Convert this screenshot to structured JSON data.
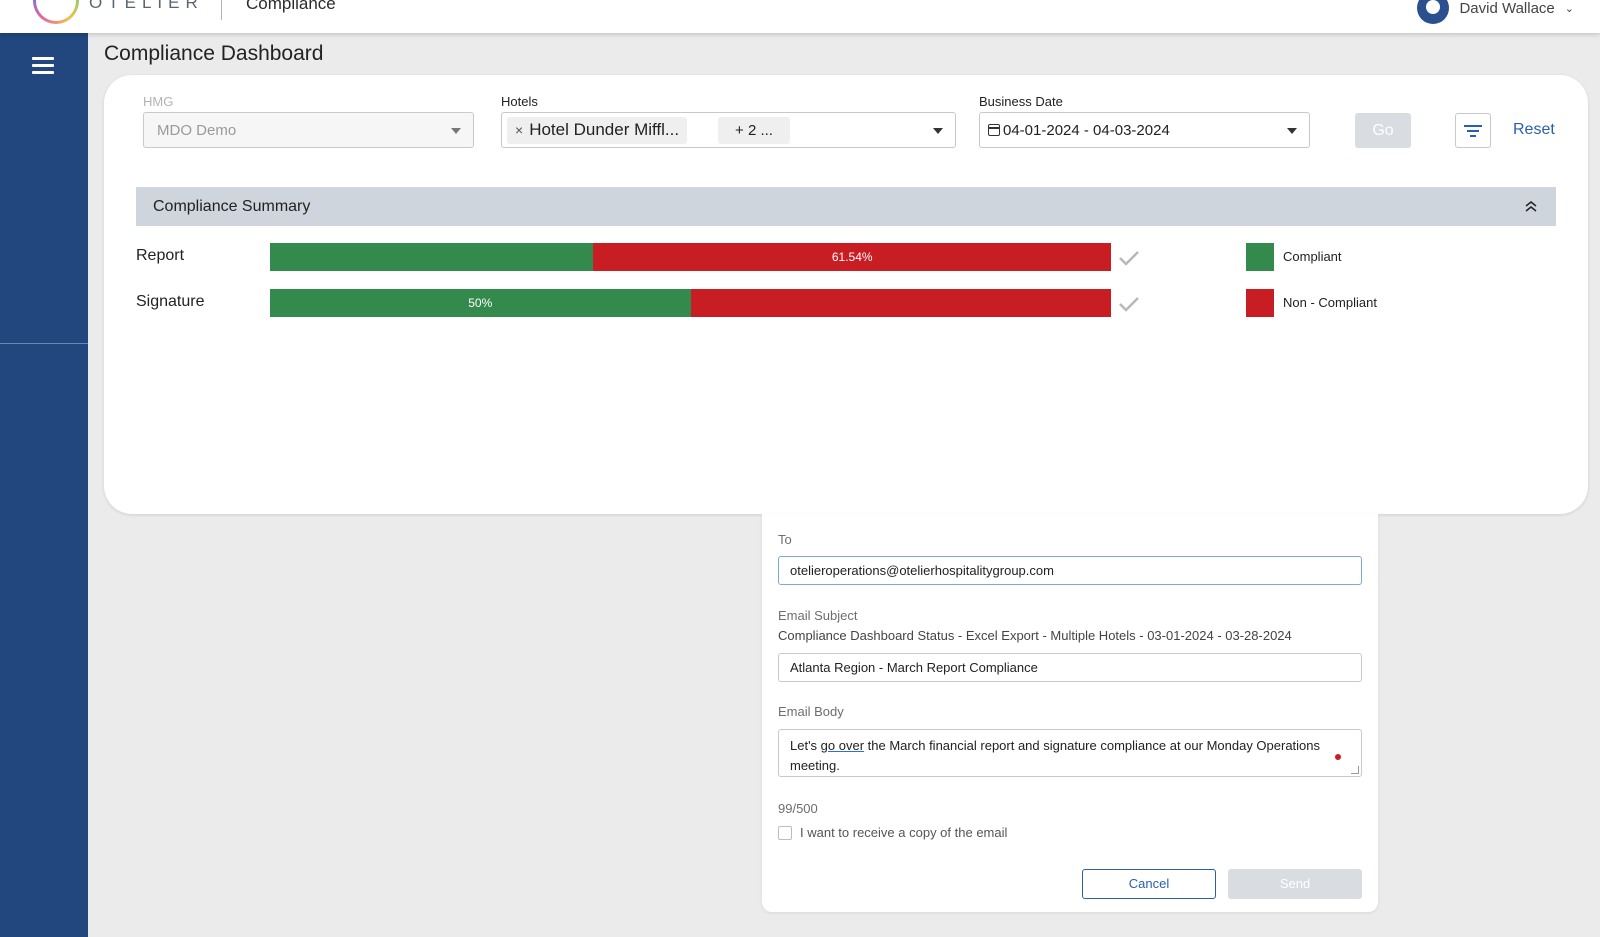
{
  "header": {
    "logo_text": "OTELIER",
    "module_title": "Compliance",
    "user_name": "David Wallace"
  },
  "page": {
    "title": "Compliance Dashboard"
  },
  "filters": {
    "hmg_label": "HMG",
    "hmg_value": "MDO Demo",
    "hotels_label": "Hotels",
    "hotels_chip": "Hotel Dunder Miffl...",
    "hotels_more": "+ 2 ...",
    "business_date_label": "Business Date",
    "business_date_value": "04-01-2024 - 04-03-2024",
    "go_label": "Go",
    "reset_label": "Reset"
  },
  "summary": {
    "title": "Compliance Summary",
    "rows": [
      {
        "label": "Report",
        "compliant_fraction": 0.3846,
        "non_compliant_fraction": 0.6154,
        "compliant_text": "",
        "non_compliant_text": "61.54%"
      },
      {
        "label": "Signature",
        "compliant_fraction": 0.5,
        "non_compliant_fraction": 0.5,
        "compliant_text": "50%",
        "non_compliant_text": ""
      }
    ],
    "legend": [
      {
        "label": "Compliant",
        "color": "#338a4c"
      },
      {
        "label": "Non - Compliant",
        "color": "#c81d22"
      }
    ]
  },
  "email": {
    "to_label": "To",
    "to_value": "otelieroperations@otelierhospitalitygroup.com",
    "subject_label": "Email Subject",
    "subject_default": "Compliance Dashboard Status - Excel Export - Multiple Hotels - 03-01-2024 - 03-28-2024",
    "subject_value": "Atlanta Region - March Report Compliance",
    "body_label": "Email Body",
    "body_prefix": "Let's ",
    "body_underlined": "go over",
    "body_suffix": " the March financial report and signature compliance at our Monday Operations meeting.",
    "char_count": "99/500",
    "copy_label": "I want to receive a copy of the email",
    "cancel_label": "Cancel",
    "send_label": "Send"
  }
}
